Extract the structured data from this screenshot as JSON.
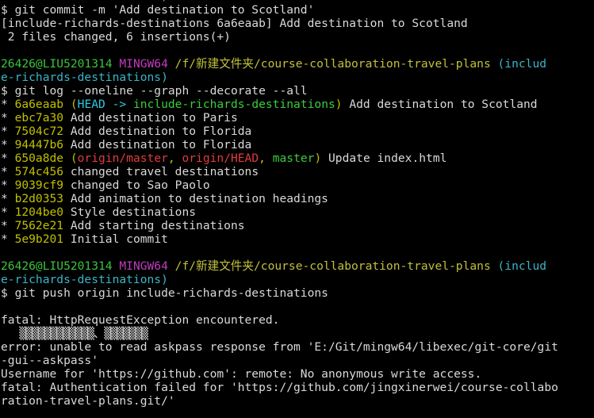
{
  "colors": {
    "default": "#d9d9d9",
    "user": "#3cc43c",
    "mingw": "#c03cc0",
    "path": "#c0c03c",
    "branch_prompt": "#3cb4c8",
    "hash": "#c0c000",
    "head": "#30c8e0",
    "local_branch": "#3ccc3c",
    "remote_branch": "#e03c3c"
  },
  "lines": [
    {
      "segments": [
        {
          "text": "e-richards-destinations)",
          "color": "branch_prompt"
        }
      ]
    },
    {
      "segments": [
        {
          "text": "$ git commit -m 'Add destination to Scotland'",
          "color": "default"
        }
      ]
    },
    {
      "segments": [
        {
          "text": "[include-richards-destinations 6a6eaab] Add destination to Scotland",
          "color": "default"
        }
      ]
    },
    {
      "segments": [
        {
          "text": " 2 files changed, 6 insertions(+)",
          "color": "default"
        }
      ]
    },
    {
      "segments": []
    },
    {
      "segments": [
        {
          "text": "26426@LIU5201314 ",
          "color": "user"
        },
        {
          "text": "MINGW64 ",
          "color": "mingw"
        },
        {
          "text": "/f/新建文件夹/course-collaboration-travel-plans ",
          "color": "path"
        },
        {
          "text": "(includ",
          "color": "branch_prompt"
        }
      ]
    },
    {
      "segments": [
        {
          "text": "e-richards-destinations)",
          "color": "branch_prompt"
        }
      ]
    },
    {
      "segments": [
        {
          "text": "$ git log --oneline --graph --decorate --all",
          "color": "default"
        }
      ]
    },
    {
      "segments": [
        {
          "text": "* ",
          "color": "default"
        },
        {
          "text": "6a6eaab ",
          "color": "hash"
        },
        {
          "text": "(",
          "color": "hash"
        },
        {
          "text": "HEAD -> ",
          "color": "head"
        },
        {
          "text": "include-richards-destinations",
          "color": "local_branch"
        },
        {
          "text": ")",
          "color": "hash"
        },
        {
          "text": " Add destination to Scotland",
          "color": "default"
        }
      ]
    },
    {
      "segments": [
        {
          "text": "* ",
          "color": "default"
        },
        {
          "text": "ebc7a30",
          "color": "hash"
        },
        {
          "text": " Add destination to Paris",
          "color": "default"
        }
      ]
    },
    {
      "segments": [
        {
          "text": "* ",
          "color": "default"
        },
        {
          "text": "7504c72",
          "color": "hash"
        },
        {
          "text": " Add destination to Florida",
          "color": "default"
        }
      ]
    },
    {
      "segments": [
        {
          "text": "* ",
          "color": "default"
        },
        {
          "text": "94447b6",
          "color": "hash"
        },
        {
          "text": " Add destination to Florida",
          "color": "default"
        }
      ]
    },
    {
      "segments": [
        {
          "text": "* ",
          "color": "default"
        },
        {
          "text": "650a8de ",
          "color": "hash"
        },
        {
          "text": "(",
          "color": "hash"
        },
        {
          "text": "origin/master",
          "color": "remote_branch"
        },
        {
          "text": ", ",
          "color": "hash"
        },
        {
          "text": "origin/HEAD",
          "color": "remote_branch"
        },
        {
          "text": ", ",
          "color": "hash"
        },
        {
          "text": "master",
          "color": "local_branch"
        },
        {
          "text": ")",
          "color": "hash"
        },
        {
          "text": " Update index.html",
          "color": "default"
        }
      ]
    },
    {
      "segments": [
        {
          "text": "* ",
          "color": "default"
        },
        {
          "text": "574c456",
          "color": "hash"
        },
        {
          "text": " changed travel destinations",
          "color": "default"
        }
      ]
    },
    {
      "segments": [
        {
          "text": "* ",
          "color": "default"
        },
        {
          "text": "9039cf9",
          "color": "hash"
        },
        {
          "text": " changed to Sao Paolo",
          "color": "default"
        }
      ]
    },
    {
      "segments": [
        {
          "text": "* ",
          "color": "default"
        },
        {
          "text": "b2d0353",
          "color": "hash"
        },
        {
          "text": " Add animation to destination headings",
          "color": "default"
        }
      ]
    },
    {
      "segments": [
        {
          "text": "* ",
          "color": "default"
        },
        {
          "text": "1204be0",
          "color": "hash"
        },
        {
          "text": " Style destinations",
          "color": "default"
        }
      ]
    },
    {
      "segments": [
        {
          "text": "* ",
          "color": "default"
        },
        {
          "text": "7562e21",
          "color": "hash"
        },
        {
          "text": " Add starting destinations",
          "color": "default"
        }
      ]
    },
    {
      "segments": [
        {
          "text": "* ",
          "color": "default"
        },
        {
          "text": "5e9b201",
          "color": "hash"
        },
        {
          "text": " Initial commit",
          "color": "default"
        }
      ]
    },
    {
      "segments": []
    },
    {
      "segments": [
        {
          "text": "26426@LIU5201314 ",
          "color": "user"
        },
        {
          "text": "MINGW64 ",
          "color": "mingw"
        },
        {
          "text": "/f/新建文件夹/course-collaboration-travel-plans ",
          "color": "path"
        },
        {
          "text": "(includ",
          "color": "branch_prompt"
        }
      ]
    },
    {
      "segments": [
        {
          "text": "e-richards-destinations)",
          "color": "branch_prompt"
        }
      ]
    },
    {
      "segments": [
        {
          "text": "$ git push origin include-richards-destinations",
          "color": "default"
        }
      ]
    },
    {
      "segments": []
    },
    {
      "segments": [
        {
          "text": "fatal: HttpRequestException encountered.",
          "color": "default"
        }
      ]
    },
    {
      "segments": [
        {
          "text": "   ▒▒▒▒▒▒▒▒▒▒▒▒、▒▒▒▒▒▒▒",
          "color": "default",
          "garble": true
        }
      ]
    },
    {
      "segments": [
        {
          "text": "error: unable to read askpass response from 'E:/Git/mingw64/libexec/git-core/git",
          "color": "default"
        }
      ]
    },
    {
      "segments": [
        {
          "text": "-gui--askpass'",
          "color": "default"
        }
      ]
    },
    {
      "segments": [
        {
          "text": "Username for 'https://github.com': remote: No anonymous write access.",
          "color": "default"
        }
      ]
    },
    {
      "segments": [
        {
          "text": "fatal: Authentication failed for 'https://github.com/jingxinerwei/course-collabo",
          "color": "default"
        }
      ]
    },
    {
      "segments": [
        {
          "text": "ration-travel-plans.git/'",
          "color": "default"
        }
      ]
    }
  ]
}
